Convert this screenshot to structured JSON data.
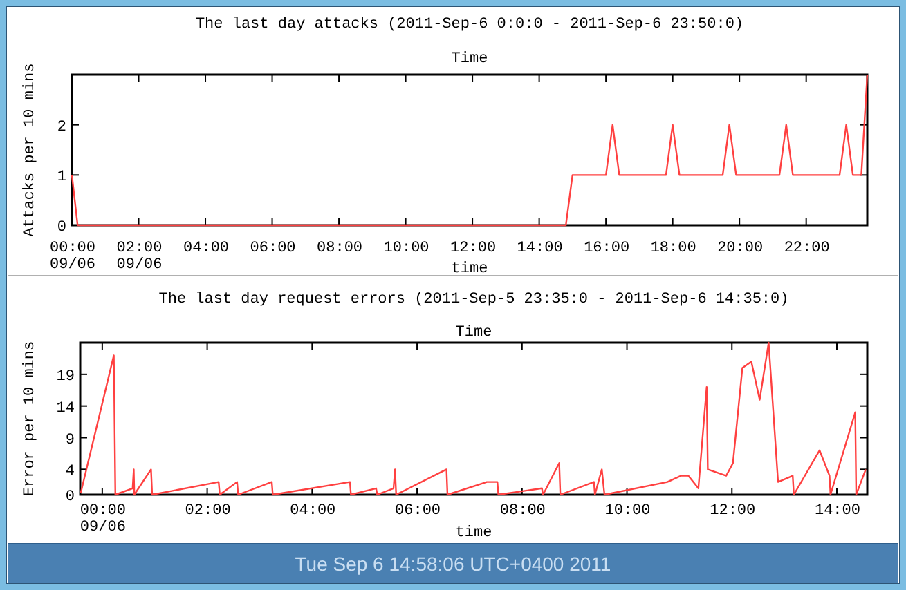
{
  "charts": [
    {
      "top_label": "Time",
      "chart_data": {
        "type": "line",
        "title": "The last day attacks (2011-Sep-6 0:0:0 - 2011-Sep-6 23:50:0)",
        "xlabel": "time",
        "ylabel": "Attacks per 10 mins",
        "xlim": [
          0,
          23.83
        ],
        "ylim": [
          0,
          3
        ],
        "x": [
          0,
          0.17,
          14.8,
          15.0,
          16.0,
          16.2,
          16.4,
          17.8,
          18.0,
          18.2,
          19.5,
          19.7,
          19.9,
          21.2,
          21.4,
          21.6,
          23.0,
          23.2,
          23.4,
          23.65,
          23.83
        ],
        "series": [
          {
            "color": "#ff4040",
            "values": [
              1,
              0,
              0,
              1,
              1,
              2,
              1,
              1,
              2,
              1,
              1,
              2,
              1,
              1,
              2,
              1,
              1,
              2,
              1,
              1,
              3
            ]
          }
        ],
        "xticks": [
          {
            "value": 0,
            "label": "00:00\n09/06"
          },
          {
            "value": 2,
            "label": "02:00\n09/06"
          },
          {
            "value": 4,
            "label": "04:00"
          },
          {
            "value": 6,
            "label": "06:00"
          },
          {
            "value": 8,
            "label": "08:00"
          },
          {
            "value": 10,
            "label": "10:00"
          },
          {
            "value": 12,
            "label": "12:00"
          },
          {
            "value": 14,
            "label": "14:00"
          },
          {
            "value": 16,
            "label": "16:00"
          },
          {
            "value": 18,
            "label": "18:00"
          },
          {
            "value": 20,
            "label": "20:00"
          },
          {
            "value": 22,
            "label": "22:00"
          }
        ],
        "yticks": [
          0,
          1,
          2
        ]
      }
    },
    {
      "top_label": "Time",
      "chart_data": {
        "type": "line",
        "title": "The last day request errors (2011-Sep-5 23:35:0 - 2011-Sep-6 14:35:0)",
        "xlabel": "time",
        "ylabel": "Error per 10 mins",
        "xlim": [
          -0.42,
          14.58
        ],
        "ylim": [
          0,
          24
        ],
        "x": [
          -0.41,
          0.22,
          0.25,
          0.58,
          0.6,
          0.61,
          0.93,
          0.95,
          2.22,
          2.24,
          2.57,
          2.59,
          3.23,
          3.25,
          4.72,
          4.74,
          5.22,
          5.24,
          5.55,
          5.58,
          5.6,
          6.56,
          6.58,
          7.33,
          7.53,
          7.55,
          8.38,
          8.4,
          8.71,
          8.73,
          9.37,
          9.39,
          9.52,
          9.57,
          10.77,
          11.03,
          11.17,
          11.36,
          11.52,
          11.54,
          11.89,
          12.02,
          12.2,
          12.37,
          12.53,
          12.7,
          12.88,
          13.16,
          13.18,
          13.67,
          13.86,
          13.88,
          14.35,
          14.37,
          14.55
        ],
        "series": [
          {
            "color": "#ff4040",
            "values": [
              0.3,
              22,
              0,
              1,
              4,
              0,
              4,
              0,
              2,
              0,
              2,
              0,
              2,
              0,
              2,
              0,
              1,
              0,
              1,
              4,
              0,
              4,
              0,
              2,
              2,
              0,
              1,
              0,
              5,
              0,
              2,
              0,
              4,
              0,
              2,
              3,
              3,
              1,
              17,
              4,
              3,
              5,
              20,
              21,
              15,
              24,
              2,
              3,
              0,
              7,
              3,
              0,
              13,
              0,
              4
            ]
          }
        ],
        "xticks": [
          {
            "value": 0,
            "label": "00:00\n09/06"
          },
          {
            "value": 2,
            "label": "02:00"
          },
          {
            "value": 4,
            "label": "04:00"
          },
          {
            "value": 6,
            "label": "06:00"
          },
          {
            "value": 8,
            "label": "08:00"
          },
          {
            "value": 10,
            "label": "10:00"
          },
          {
            "value": 12,
            "label": "12:00"
          },
          {
            "value": 14,
            "label": "14:00"
          }
        ],
        "yticks": [
          0,
          4,
          9,
          14,
          19
        ]
      }
    }
  ],
  "status_bar": {
    "text": "Tue Sep 6 14:58:06 UTC+0400 2011"
  }
}
